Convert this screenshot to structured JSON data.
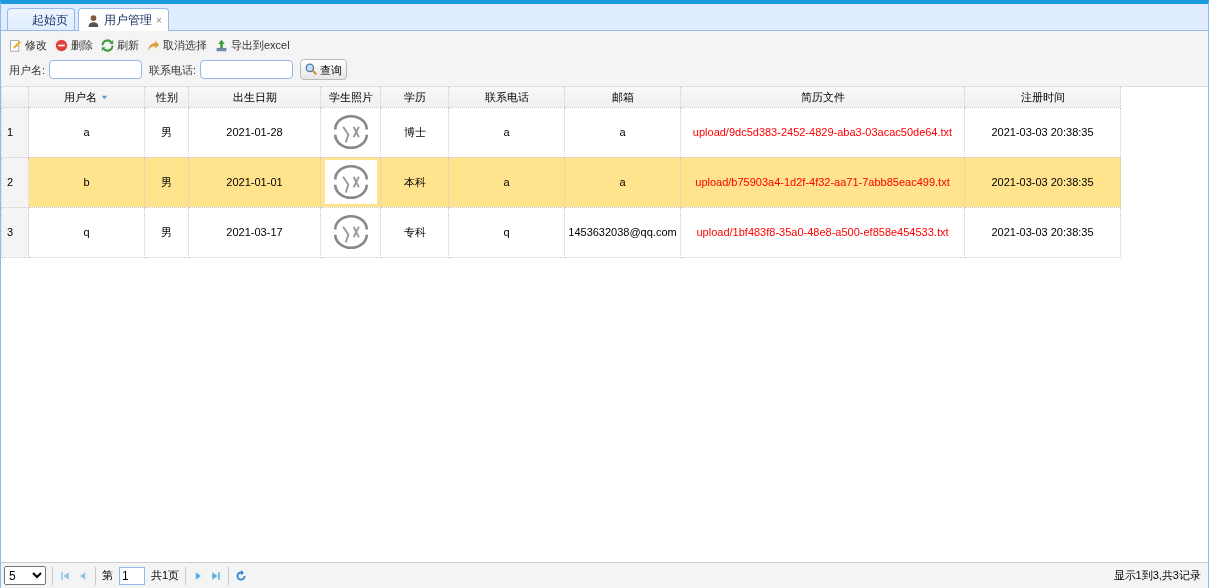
{
  "tabs": [
    {
      "label": "起始页",
      "selected": false,
      "kind": "plain"
    },
    {
      "label": "用户管理",
      "selected": true,
      "kind": "person",
      "close": "×"
    }
  ],
  "toolbar": [
    {
      "label": "修改",
      "kind": "edit"
    },
    {
      "label": "删除",
      "kind": "delete"
    },
    {
      "label": "刷新",
      "kind": "refresh"
    },
    {
      "label": "取消选择",
      "kind": "undo"
    },
    {
      "label": "导出到excel",
      "kind": "export"
    }
  ],
  "search": {
    "fields": [
      {
        "label": "用户名:"
      },
      {
        "label": "联系电话:"
      }
    ],
    "button": "查询"
  },
  "table": {
    "columns": [
      {
        "label": "用户名",
        "sorted": true
      },
      {
        "label": "性别",
        "sorted": false
      },
      {
        "label": "出生日期",
        "sorted": false
      },
      {
        "label": "学生照片",
        "sorted": false
      },
      {
        "label": "学历",
        "sorted": false
      },
      {
        "label": "联系电话",
        "sorted": false
      },
      {
        "label": "邮箱",
        "sorted": false
      },
      {
        "label": "简历文件",
        "sorted": false
      },
      {
        "label": "注册时间",
        "sorted": false
      }
    ],
    "rows": [
      {
        "index": "1",
        "selected": false,
        "username": "a",
        "gender": "男",
        "birthdate": "2021-01-28",
        "education": "博士",
        "phone": "a",
        "email": "a",
        "resume": "upload/9dc5d383-2452-4829-aba3-03acac50de64.txt",
        "registered": "2021-03-03 20:38:35"
      },
      {
        "index": "2",
        "selected": true,
        "username": "b",
        "gender": "男",
        "birthdate": "2021-01-01",
        "education": "本科",
        "phone": "a",
        "email": "a",
        "resume": "upload/b75903a4-1d2f-4f32-aa71-7abb85eac499.txt",
        "registered": "2021-03-03 20:38:35"
      },
      {
        "index": "3",
        "selected": false,
        "username": "q",
        "gender": "男",
        "birthdate": "2021-03-17",
        "education": "专科",
        "phone": "q",
        "email": "1453632038@qq.com",
        "resume": "upload/1bf483f8-35a0-48e8-a500-ef858e454533.txt",
        "registered": "2021-03-03 20:38:35"
      }
    ]
  },
  "pager": {
    "page_size": "5",
    "before": "第",
    "page": "1",
    "after": "共1页",
    "info": "显示1到3,共3记录"
  }
}
